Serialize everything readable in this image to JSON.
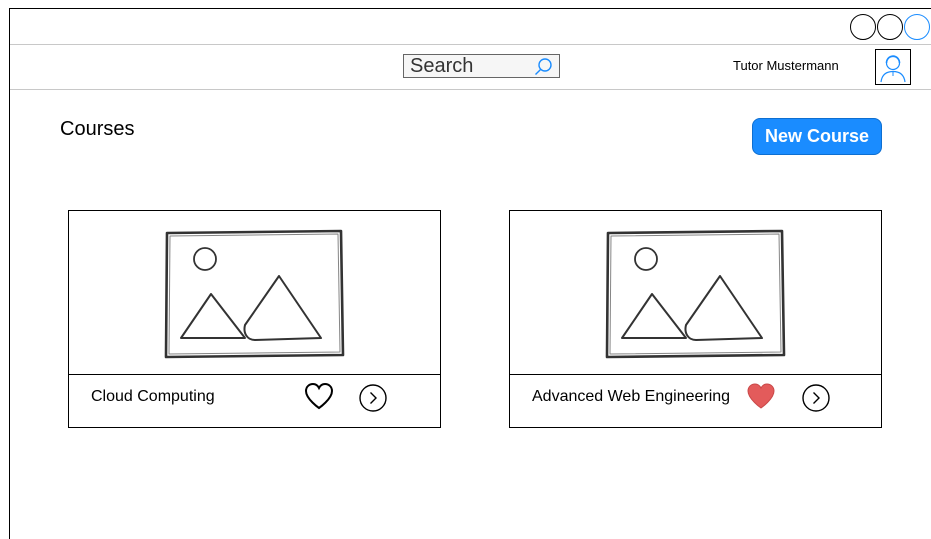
{
  "header": {
    "search": {
      "placeholder": "Search"
    },
    "user": {
      "name": "Tutor Mustermann"
    }
  },
  "main": {
    "title": "Courses",
    "new_course_label": "New Course",
    "courses": [
      {
        "title": "Cloud Computing",
        "favorited": false,
        "icons": [
          "image-placeholder-icon",
          "heart-outline-icon",
          "chevron-right-circle-icon"
        ]
      },
      {
        "title": "Advanced Web Engineering",
        "favorited": true,
        "icons": [
          "image-placeholder-icon",
          "heart-filled-icon",
          "chevron-right-circle-icon"
        ]
      }
    ]
  },
  "colors": {
    "accent": "#1a8cff",
    "favorite": "#e35b5b"
  }
}
